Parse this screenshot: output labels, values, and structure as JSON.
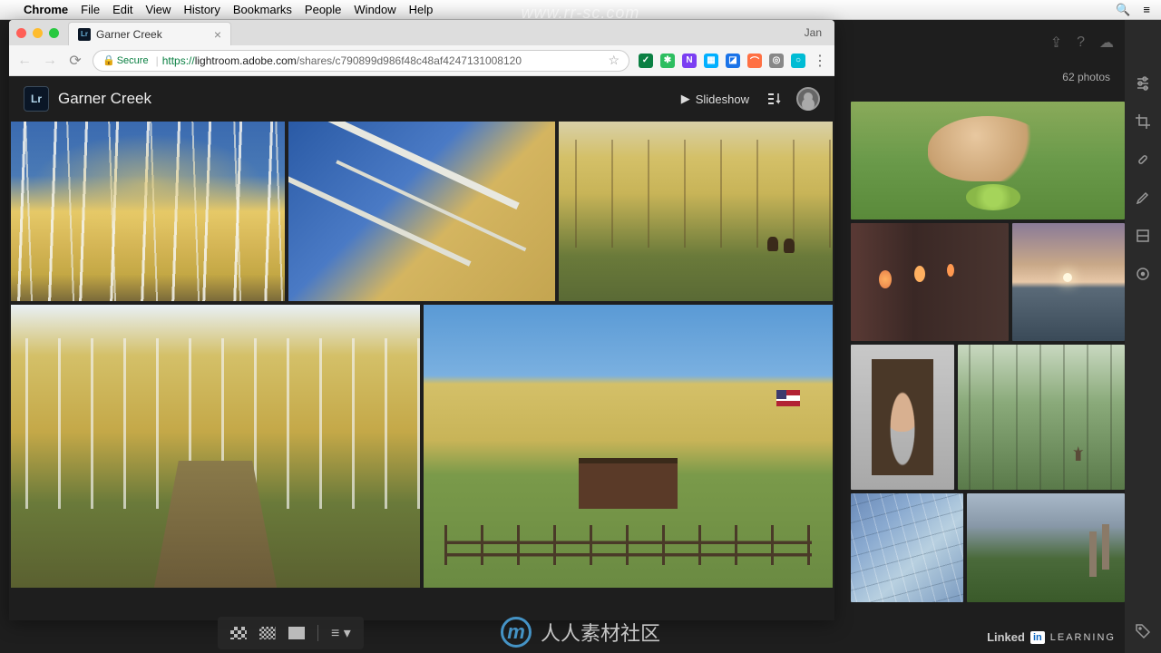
{
  "mac_menu": {
    "app": "Chrome",
    "items": [
      "File",
      "Edit",
      "View",
      "History",
      "Bookmarks",
      "People",
      "Window",
      "Help"
    ]
  },
  "browser": {
    "tab_title": "Garner Creek",
    "tab_favicon": "Lr",
    "user": "Jan",
    "secure_label": "Secure",
    "url_scheme": "https://",
    "url_domain": "lightroom.adobe.com",
    "url_path": "/shares/c790899d986f48c48af4247131008120"
  },
  "lightroom": {
    "logo": "Lr",
    "title": "Garner Creek",
    "slideshow": "Slideshow",
    "photo_count": "62 photos"
  },
  "watermark": {
    "url": "www.rr-sc.com",
    "text": "人人素材社区"
  },
  "linkedin": {
    "brand": "Linked",
    "in": "in",
    "suffix": "LEARNING"
  }
}
